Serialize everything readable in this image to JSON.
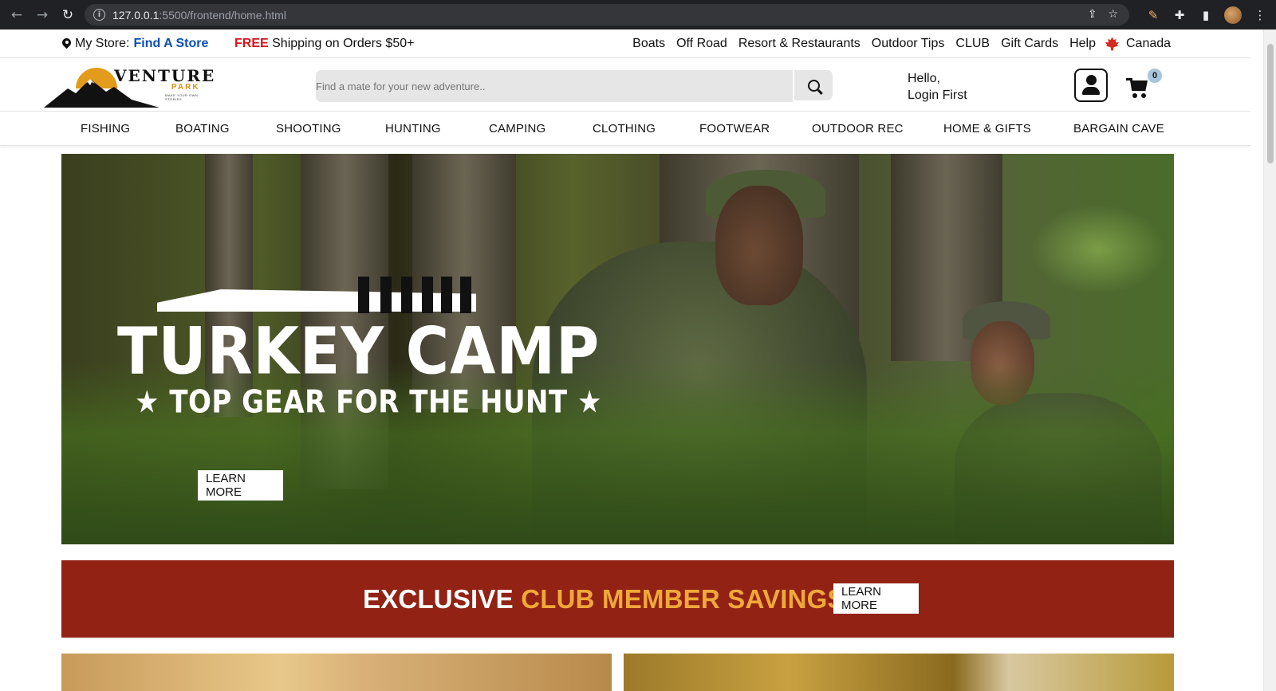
{
  "browser": {
    "url_host": "127.0.0.1",
    "url_rest": ":5500/frontend/home.html"
  },
  "topbar": {
    "store_prefix": "My Store:",
    "store_link": "Find A Store",
    "free_label": "FREE",
    "shipping_text": "Shipping on Orders $50+",
    "links": [
      "Boats",
      "Off Road",
      "Resort & Restaurants",
      "Outdoor Tips",
      "CLUB",
      "Gift Cards",
      "Help"
    ],
    "country": "Canada"
  },
  "header": {
    "logo_main": "VENTURE",
    "logo_sub": "PARK",
    "logo_tagline": "MAKE YOUR OWN STORIES",
    "search_placeholder": "Find a mate for your new adventure..",
    "greeting_line1": "Hello,",
    "greeting_line2": "Login First",
    "cart_count": "0"
  },
  "categories": [
    "FISHING",
    "BOATING",
    "SHOOTING",
    "HUNTING",
    "CAMPING",
    "CLOTHING",
    "FOOTWEAR",
    "OUTDOOR REC",
    "HOME & GIFTS",
    "BARGAIN CAVE"
  ],
  "hero": {
    "title": "TURKEY CAMP",
    "subtitle": "★ TOP GEAR FOR THE HUNT ★",
    "button": "LEARN MORE"
  },
  "club_banner": {
    "word1": "EXCLUSIVE",
    "word2": "CLUB MEMBER SAVINGS",
    "button": "LEARN MORE",
    "color_bg": "#912214",
    "color_accent": "#f0a83a"
  },
  "colors": {
    "link_blue": "#0b4fb3",
    "free_red": "#d4161c"
  }
}
